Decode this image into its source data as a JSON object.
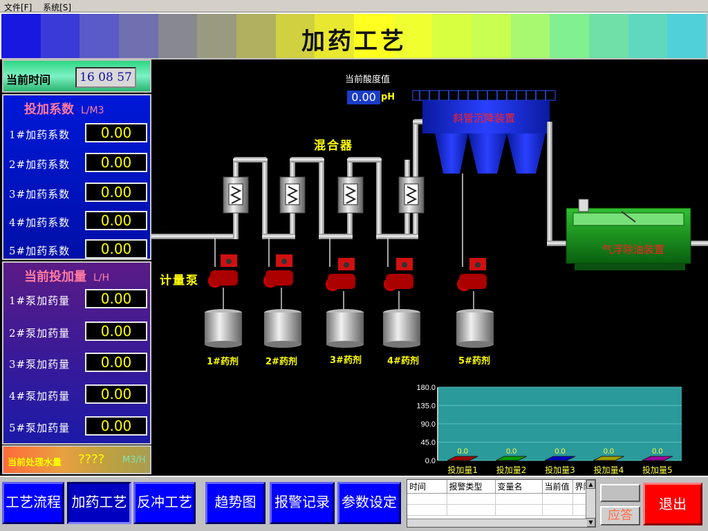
{
  "menu": {
    "file": "文件[F]",
    "system": "系统[S]"
  },
  "banner": {
    "title": "加药工艺"
  },
  "time": {
    "label": "当前时间",
    "value": "16 08 57"
  },
  "coef": {
    "title": "投加系数",
    "unit": "L/M3",
    "rows": [
      {
        "label": "1#加药系数",
        "value": "0.00"
      },
      {
        "label": "2#加药系数",
        "value": "0.00"
      },
      {
        "label": "3#加药系数",
        "value": "0.00"
      },
      {
        "label": "4#加药系数",
        "value": "0.00"
      },
      {
        "label": "5#加药系数",
        "value": "0.00"
      }
    ]
  },
  "dose": {
    "title": "当前投加量",
    "unit": "L/H",
    "rows": [
      {
        "label": "1#泵加药量",
        "value": "0.00"
      },
      {
        "label": "2#泵加药量",
        "value": "0.00"
      },
      {
        "label": "3#泵加药量",
        "value": "0.00"
      },
      {
        "label": "4#泵加药量",
        "value": "0.00"
      },
      {
        "label": "5#泵加药量",
        "value": "0.00"
      }
    ]
  },
  "water": {
    "label": "当前处理水量",
    "value": "????",
    "unit": "M3/H"
  },
  "schematic": {
    "ph_label": "当前酸度值",
    "ph_value": "0.00",
    "ph_unit": "pH",
    "mixer_label": "混合器",
    "pump_label": "计量泵",
    "settler_label": "斜管沉降装置",
    "float_label": "气浮除油装置",
    "tanks": [
      "1#药剂",
      "2#药剂",
      "3#药剂",
      "4#药剂",
      "5#药剂"
    ]
  },
  "chart_data": {
    "type": "bar",
    "categories": [
      "投加量1",
      "投加量2",
      "投加量3",
      "投加量4",
      "投加量5"
    ],
    "values": [
      0.0,
      0.0,
      0.0,
      0.0,
      0.0
    ],
    "value_labels": [
      "0.0",
      "0.0",
      "0.0",
      "0.0",
      "0.0"
    ],
    "bar_colors": [
      "#a00000",
      "#00a000",
      "#0000c0",
      "#a0a000",
      "#a000a0"
    ],
    "yticks": [
      "180.0",
      "135.0",
      "90.0",
      "45.0",
      "0.0"
    ],
    "ylim": [
      0,
      180
    ]
  },
  "nav": [
    {
      "label": "工艺流程"
    },
    {
      "label": "加药工艺"
    },
    {
      "label": "反冲工艺"
    },
    {
      "label": "趋势图"
    },
    {
      "label": "报警记录"
    },
    {
      "label": "参数设定"
    }
  ],
  "alarm": {
    "columns": [
      "时间",
      "报警类型",
      "变量名",
      "当前值",
      "界限"
    ]
  },
  "ack_label": "应答",
  "exit_label": "退出",
  "colors": {
    "panel_blue": "#0018d8",
    "value_yellow": "#ffff00",
    "exit_red": "#ff0000"
  }
}
